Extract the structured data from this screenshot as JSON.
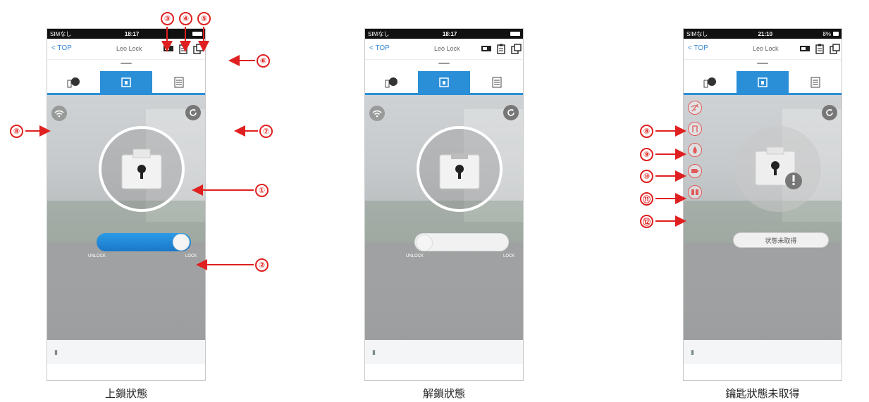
{
  "phones": [
    {
      "status": {
        "carrier": "SIMなし",
        "time": "18:17"
      },
      "nav": {
        "back": "TOP",
        "title": "Leo Lock"
      },
      "slider": {
        "left_label": "UNLOCK",
        "right_label": "LOCK",
        "state": "locked"
      },
      "caption": "上鎖狀態"
    },
    {
      "status": {
        "carrier": "SIMなし",
        "time": "18:17"
      },
      "nav": {
        "back": "TOP",
        "title": "Leo Lock"
      },
      "slider": {
        "left_label": "UNLOCK",
        "right_label": "LOCK",
        "state": "unlocked"
      },
      "caption": "解鎖狀態"
    },
    {
      "status": {
        "carrier": "SIMなし",
        "time": "21:10",
        "battery": "8%"
      },
      "nav": {
        "back": "TOP",
        "title": "Leo Lock"
      },
      "status_pill": "状態未取得",
      "caption": "鑰匙狀態未取得"
    }
  ],
  "markers": {
    "m1": "①",
    "m2": "②",
    "m3": "③",
    "m4": "④",
    "m5": "⑤",
    "m6": "⑥",
    "m7": "⑦",
    "m8": "⑧",
    "m9": "⑨",
    "m10": "⑩",
    "m11": "⑪",
    "m12": "⑫"
  },
  "colors": {
    "accent": "#2b8fd8",
    "marker": "#e02020"
  }
}
